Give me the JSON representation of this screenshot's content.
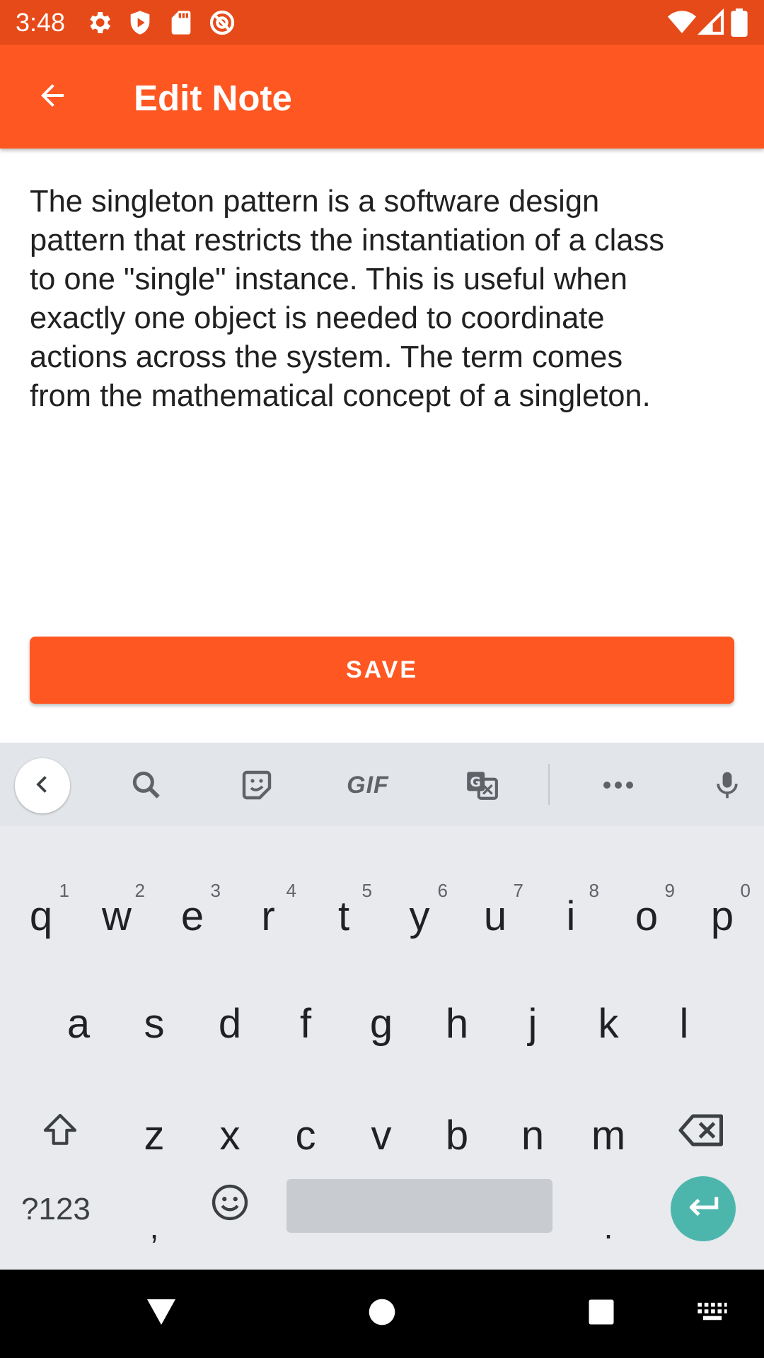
{
  "status_bar": {
    "time": "3:48",
    "icons": [
      "settings-icon",
      "shield-icon",
      "sd-card-icon",
      "no-disturb-icon",
      "wifi-icon",
      "signal-icon",
      "battery-icon"
    ]
  },
  "app_bar": {
    "title": "Edit Note",
    "color": "#FF5722"
  },
  "note": {
    "text": "The singleton pattern is a software design\npattern that restricts the instantiation of a class\nto one \"single\" instance. This is useful when\nexactly one object is needed to coordinate\nactions across the system. The term comes\nfrom the mathematical concept of a singleton."
  },
  "save_button": {
    "label": "SAVE"
  },
  "keyboard": {
    "toolbar": {
      "gif_label": "GIF",
      "icons": [
        "chevron-left-icon",
        "search-icon",
        "sticker-icon",
        "gif-icon",
        "translate-icon",
        "more-icon",
        "mic-icon"
      ]
    },
    "row1": [
      {
        "key": "q",
        "hint": "1"
      },
      {
        "key": "w",
        "hint": "2"
      },
      {
        "key": "e",
        "hint": "3"
      },
      {
        "key": "r",
        "hint": "4"
      },
      {
        "key": "t",
        "hint": "5"
      },
      {
        "key": "y",
        "hint": "6"
      },
      {
        "key": "u",
        "hint": "7"
      },
      {
        "key": "i",
        "hint": "8"
      },
      {
        "key": "o",
        "hint": "9"
      },
      {
        "key": "p",
        "hint": "0"
      }
    ],
    "row2": [
      "a",
      "s",
      "d",
      "f",
      "g",
      "h",
      "j",
      "k",
      "l"
    ],
    "row3": [
      "z",
      "x",
      "c",
      "v",
      "b",
      "n",
      "m"
    ],
    "symbols_label": "?123",
    "comma": ",",
    "period": ".",
    "enter_color": "#4DB6AC"
  },
  "nav_bar": {
    "icons": [
      "back-triangle-icon",
      "home-circle-icon",
      "recents-square-icon",
      "keyboard-switch-icon"
    ]
  }
}
